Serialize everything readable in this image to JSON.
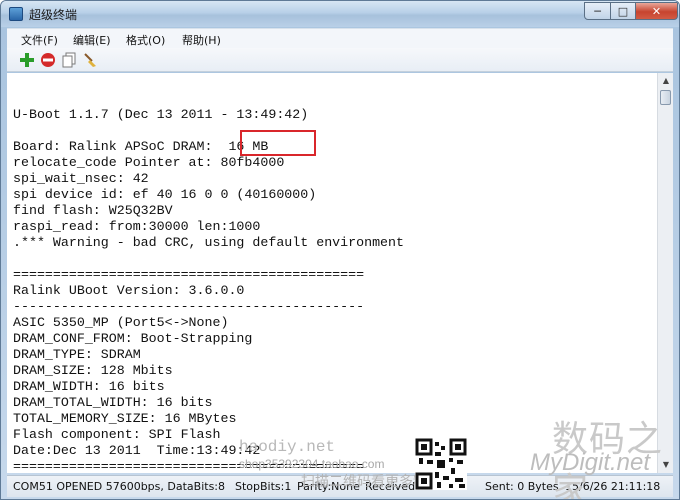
{
  "window": {
    "title": "超级终端"
  },
  "window_controls": {
    "minimize": "─",
    "maximize": "□",
    "close": "✕"
  },
  "menu": {
    "items": [
      {
        "label": "文件(F)"
      },
      {
        "label": "编辑(E)"
      },
      {
        "label": "格式(O)"
      },
      {
        "label": "帮助(H)"
      }
    ]
  },
  "toolbar": {
    "buttons": [
      {
        "icon": "add-icon",
        "color": "#2a9d2a"
      },
      {
        "icon": "stop-icon",
        "color": "#d42a2a"
      },
      {
        "icon": "copy-icon",
        "color": "#7a7a7a"
      },
      {
        "icon": "broom-icon",
        "color": "#c79a3b"
      }
    ]
  },
  "console": {
    "lines": [
      "",
      "",
      "U-Boot 1.1.7 (Dec 13 2011 - 13:49:42)",
      "",
      "Board: Ralink APSoC DRAM:  16 MB",
      "relocate_code Pointer at: 80fb4000",
      "spi_wait_nsec: 42",
      "spi device id: ef 40 16 0 0 (40160000)",
      "find flash: W25Q32BV",
      "raspi_read: from:30000 len:1000",
      ".*** Warning - bad CRC, using default environment",
      "",
      "============================================",
      "Ralink UBoot Version: 3.6.0.0",
      "--------------------------------------------",
      "ASIC 5350_MP (Port5<->None)",
      "DRAM_CONF_FROM: Boot-Strapping",
      "DRAM_TYPE: SDRAM",
      "DRAM_SIZE: 128 Mbits",
      "DRAM_WIDTH: 16 bits",
      "DRAM_TOTAL_WIDTH: 16 bits",
      "TOTAL_MEMORY_SIZE: 16 MBytes",
      "Flash component: SPI Flash",
      "Date:Dec 13 2011  Time:13:49:42",
      "============================================"
    ],
    "highlight_color": "#d9262b"
  },
  "statusbar": {
    "port": "COM51 OPENED 57600bps, DataBits:8",
    "stopbits": "StopBits:1",
    "parity": "Parity:None",
    "received": "Received:",
    "sent": "Sent: 0 Bytes",
    "datetime": "15/6/26 21:11:18"
  },
  "watermarks": {
    "site": "haodiy.net",
    "shop": "shop35392304.taobao.com",
    "brand_cn": "数码之家",
    "brand_en": "MyDigit.net",
    "slogan_cn": "扫描二维码看更多精彩"
  }
}
